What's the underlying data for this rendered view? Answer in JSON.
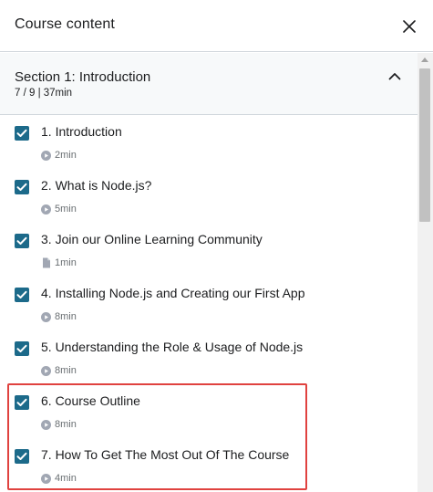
{
  "header": {
    "title": "Course content",
    "close_icon": "close-icon"
  },
  "section": {
    "title": "Section 1: Introduction",
    "meta": "7 / 9 | 37min",
    "collapse_icon": "chevron-up-icon"
  },
  "lectures": [
    {
      "title": "1. Introduction",
      "duration": "2min",
      "type": "video",
      "completed": true
    },
    {
      "title": "2. What is Node.js?",
      "duration": "5min",
      "type": "video",
      "completed": true
    },
    {
      "title": "3. Join our Online Learning Community",
      "duration": "1min",
      "type": "article",
      "completed": true
    },
    {
      "title": "4. Installing Node.js and Creating our First App",
      "duration": "8min",
      "type": "video",
      "completed": true
    },
    {
      "title": "5. Understanding the Role & Usage of Node.js",
      "duration": "8min",
      "type": "video",
      "completed": true
    },
    {
      "title": "6. Course Outline",
      "duration": "8min",
      "type": "video",
      "completed": true
    },
    {
      "title": "7. How To Get The Most Out Of The Course",
      "duration": "4min",
      "type": "video",
      "completed": true
    }
  ],
  "colors": {
    "checkbox": "#1c6a8a",
    "highlight": "#e0423f",
    "section_bg": "#f7f9fa"
  }
}
